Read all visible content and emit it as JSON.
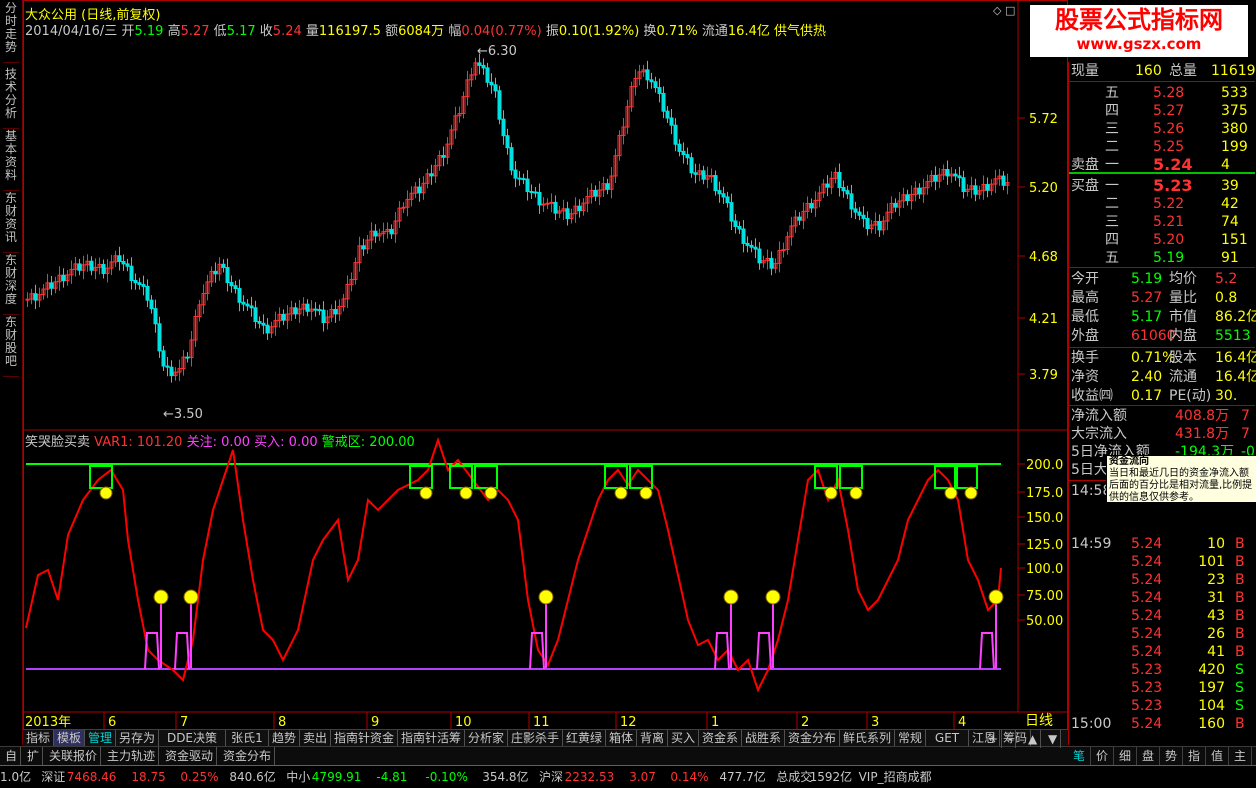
{
  "window_icons": {
    "diamond": "◇",
    "close": "□"
  },
  "left_tabs": [
    "分时走势",
    "技术分析",
    "基本资料",
    "东财资讯",
    "东财深度",
    "东财股吧"
  ],
  "header": {
    "stock_name": "大众公用",
    "period": "(日线,前复权)",
    "date": "2014/04/16/三",
    "open_label": "开",
    "open": "5.19",
    "high_label": "高",
    "high": "5.27",
    "low_label": "低",
    "low": "5.17",
    "close_label": "收",
    "close": "5.24",
    "vol_label": "量",
    "vol": "116197.5",
    "amount_label": "额",
    "amount": "6084万",
    "chg_label": "幅",
    "chg": "0.04(0.77%)",
    "amp_label": "振",
    "amp": "0.10(1.92%)",
    "turnover_label": "换",
    "turnover": "0.71%",
    "float_label": "流通",
    "float": "16.4亿",
    "sector": "供气供热"
  },
  "price_axis": [
    "5.72",
    "5.20",
    "4.68",
    "4.21",
    "3.79"
  ],
  "price_marks": {
    "max": "6.30",
    "min": "3.50"
  },
  "indicator_header": {
    "name": "笑哭脸买卖",
    "var1": "VAR1: 101.20",
    "attention": "关注: 0.00",
    "buy": "买入: 0.00",
    "warn": "警戒区: 200.00"
  },
  "indicator_axis": [
    "200.0",
    "175.0",
    "150.0",
    "125.0",
    "100.0",
    "75.00",
    "50.00"
  ],
  "x_axis": {
    "year": "2013年",
    "months": [
      "6",
      "7",
      "8",
      "9",
      "10",
      "11",
      "12",
      "1",
      "2",
      "3",
      "4"
    ],
    "period_label": "日线"
  },
  "colors": {
    "up": "#ff3232",
    "down": "#00e0e0",
    "green": "#00ff00",
    "yellow": "#ffff00",
    "magenta": "#ff40ff",
    "red": "#ff0000",
    "cyan": "#00ffff"
  },
  "logo": {
    "line1": "股票公式指标网",
    "line2": "www.gszx.com"
  },
  "quote": {
    "now_vol_label": "现量",
    "now_vol": "160",
    "total_vol_label": "总量",
    "total_vol": "11619",
    "asks": [
      {
        "label": "五",
        "price": "5.28",
        "vol": "533"
      },
      {
        "label": "四",
        "price": "5.27",
        "vol": "375"
      },
      {
        "label": "三",
        "price": "5.26",
        "vol": "380"
      },
      {
        "label": "二",
        "price": "5.25",
        "vol": "199"
      },
      {
        "label": "一",
        "price": "5.24",
        "vol": "4"
      }
    ],
    "ask_label": "卖盘",
    "bid_label": "买盘",
    "bids": [
      {
        "label": "一",
        "price": "5.23",
        "vol": "39"
      },
      {
        "label": "二",
        "price": "5.22",
        "vol": "42"
      },
      {
        "label": "三",
        "price": "5.21",
        "vol": "74"
      },
      {
        "label": "四",
        "price": "5.20",
        "vol": "151"
      },
      {
        "label": "五",
        "price": "5.19",
        "vol": "91"
      }
    ],
    "stats": [
      {
        "l1": "今开",
        "v1": "5.19",
        "l2": "均价",
        "v2": "5.2"
      },
      {
        "l1": "最高",
        "v1": "5.27",
        "l2": "量比",
        "v2": "0.8"
      },
      {
        "l1": "最低",
        "v1": "5.17",
        "l2": "市值",
        "v2": "86.2亿"
      },
      {
        "l1": "外盘",
        "v1": "61060",
        "l2": "内盘",
        "v2": "5513"
      }
    ],
    "stats2": [
      {
        "l1": "换手",
        "v1": "0.71%",
        "l2": "股本",
        "v2": "16.4亿"
      },
      {
        "l1": "净资",
        "v1": "2.40",
        "l2": "流通",
        "v2": "16.4亿"
      },
      {
        "l1": "收益㈣",
        "v1": "0.17",
        "l2": "PE(动)",
        "v2": "30."
      }
    ],
    "flow": [
      {
        "label": "净流入额",
        "value": "408.8万",
        "extra": "7"
      },
      {
        "label": "大宗流入",
        "value": "431.8万",
        "extra": "7"
      },
      {
        "label": "5日净流入额",
        "value": "-194.3万",
        "extra": "-0"
      },
      {
        "label": "5日大",
        "value": "",
        "extra": ""
      }
    ],
    "tooltip": {
      "title": "资金流向",
      "text": "当日和最近几日的资金净流入额后面的百分比是相对流量,比例提供的信息仅供参考。"
    },
    "ticks": [
      {
        "time": "14:58",
        "price": "",
        "vol": "",
        "bs": ""
      },
      {
        "time": "14:59",
        "price": "5.24",
        "vol": "10",
        "bs": "B"
      },
      {
        "time": "",
        "price": "5.24",
        "vol": "101",
        "bs": "B"
      },
      {
        "time": "",
        "price": "5.24",
        "vol": "23",
        "bs": "B"
      },
      {
        "time": "",
        "price": "5.24",
        "vol": "31",
        "bs": "B"
      },
      {
        "time": "",
        "price": "5.24",
        "vol": "43",
        "bs": "B"
      },
      {
        "time": "",
        "price": "5.24",
        "vol": "26",
        "bs": "B"
      },
      {
        "time": "",
        "price": "5.24",
        "vol": "41",
        "bs": "B"
      },
      {
        "time": "",
        "price": "5.23",
        "vol": "420",
        "bs": "S"
      },
      {
        "time": "",
        "price": "5.23",
        "vol": "197",
        "bs": "S"
      },
      {
        "time": "",
        "price": "5.23",
        "vol": "104",
        "bs": "S"
      },
      {
        "time": "15:00",
        "price": "5.24",
        "vol": "160",
        "bs": "B"
      }
    ]
  },
  "indicator_tabs": [
    "指标",
    "模板",
    "管理",
    "另存为",
    "DDE决策",
    "张氏1",
    "趋势",
    "卖出",
    "指南针资金",
    "指南针活筹",
    "分析家",
    "庄影杀手",
    "红黄绿",
    "箱体",
    "背离",
    "买入",
    "资金系",
    "战胜系",
    "资金分布",
    "鲜氏系列",
    "常规",
    "GET",
    "江恩",
    "筹码"
  ],
  "tabs_row2": [
    "自",
    "扩",
    "关联报价",
    "主力轨迹",
    "资金驱动",
    "资金分布"
  ],
  "scroll_buttons": [
    "+",
    "-",
    "▲",
    "▼"
  ],
  "right_tabs": [
    "笔",
    "价",
    "细",
    "盘",
    "势",
    "指",
    "值",
    "主"
  ],
  "status": [
    {
      "label": "1.0亿",
      "color": "#c8c8c8"
    },
    {
      "label": "深证",
      "color": "#c8c8c8"
    },
    {
      "label": "7468.46",
      "color": "#ff3232"
    },
    {
      "label": "18.75",
      "color": "#ff3232"
    },
    {
      "label": "0.25%",
      "color": "#ff3232"
    },
    {
      "label": "840.6亿",
      "color": "#c8c8c8"
    },
    {
      "label": "中小",
      "color": "#c8c8c8"
    },
    {
      "label": "4799.91",
      "color": "#00ff00"
    },
    {
      "label": "-4.81",
      "color": "#00ff00"
    },
    {
      "label": "-0.10%",
      "color": "#00ff00"
    },
    {
      "label": "354.8亿",
      "color": "#c8c8c8"
    },
    {
      "label": "沪深",
      "color": "#c8c8c8"
    },
    {
      "label": "2232.53",
      "color": "#ff3232"
    },
    {
      "label": "3.07",
      "color": "#ff3232"
    },
    {
      "label": "0.14%",
      "color": "#ff3232"
    },
    {
      "label": "477.7亿",
      "color": "#c8c8c8"
    },
    {
      "label": "总成交",
      "color": "#c8c8c8"
    },
    {
      "label": "1592亿",
      "color": "#c8c8c8"
    },
    {
      "label": "VIP_招商成都",
      "color": "#c8c8c8"
    }
  ]
}
